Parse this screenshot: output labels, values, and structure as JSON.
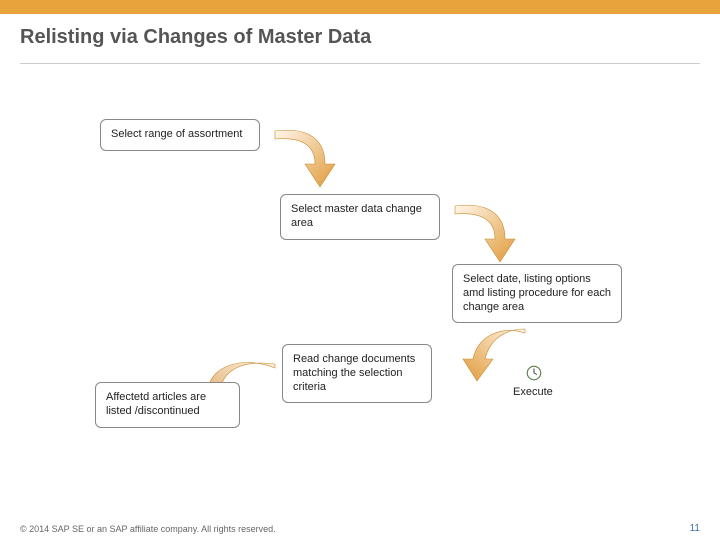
{
  "header": {
    "title": "Relisting via Changes of Master Data"
  },
  "steps": {
    "s1": "Select range of assortment",
    "s2": "Select master data change area",
    "s3": "Select date, listing options amd listing procedure for each change area",
    "s4": "Read change documents matching the selection criteria",
    "s5": "Affectetd articles are listed /discontinued",
    "execute": "Execute"
  },
  "footer": {
    "copyright": "© 2014 SAP SE or an SAP affiliate company. All rights reserved.",
    "page": "11"
  }
}
